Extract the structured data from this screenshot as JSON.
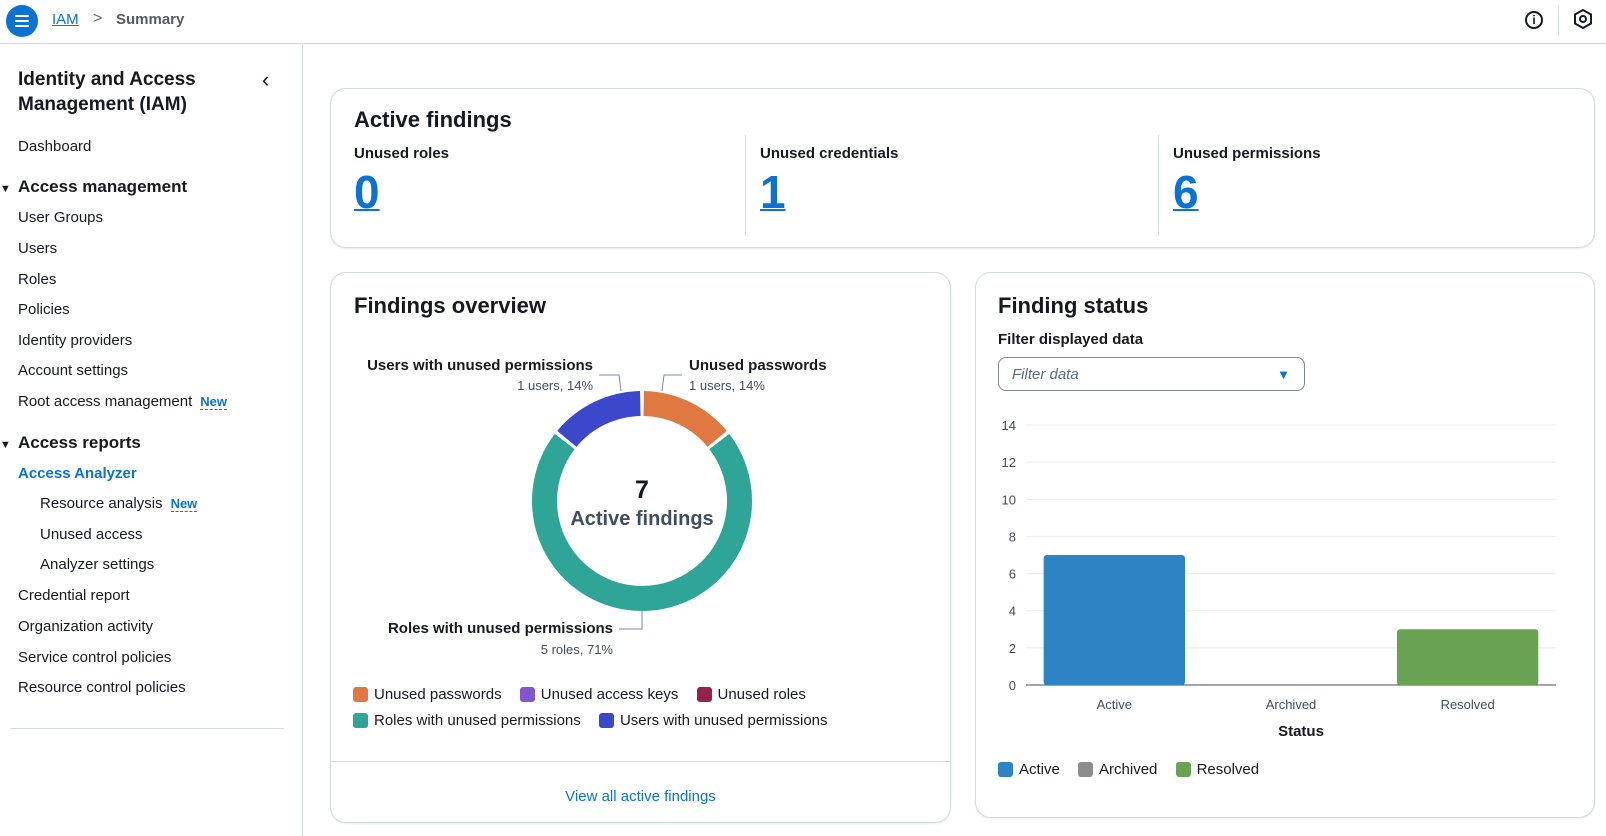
{
  "topbar": {
    "breadcrumb_root": "IAM",
    "breadcrumb_sep": ">",
    "breadcrumb_current": "Summary"
  },
  "sidebar": {
    "title": "Identity and Access Management (IAM)",
    "dashboard": "Dashboard",
    "section_access_management": "Access management",
    "access_management_items": [
      "User Groups",
      "Users",
      "Roles",
      "Policies",
      "Identity providers",
      "Account settings",
      "Root access management"
    ],
    "new_badge": "New",
    "section_access_reports": "Access reports",
    "access_analyzer": "Access Analyzer",
    "analyzer_items": [
      "Resource analysis",
      "Unused access",
      "Analyzer settings"
    ],
    "report_items": [
      "Credential report",
      "Organization activity",
      "Service control policies",
      "Resource control policies"
    ]
  },
  "active_findings": {
    "title": "Active findings",
    "metrics": [
      {
        "label": "Unused roles",
        "value": "0"
      },
      {
        "label": "Unused credentials",
        "value": "1"
      },
      {
        "label": "Unused permissions",
        "value": "6"
      }
    ]
  },
  "findings_overview": {
    "title": "Findings overview",
    "center_value": "7",
    "center_label": "Active findings",
    "callouts": {
      "users_perm_title": "Users with unused permissions",
      "users_perm_detail": "1 users, 14%",
      "passwords_title": "Unused passwords",
      "passwords_detail": "1 users, 14%",
      "roles_perm_title": "Roles with unused permissions",
      "roles_perm_detail": "5 roles, 71%"
    },
    "legend": [
      {
        "label": "Unused passwords",
        "color": "#e07941"
      },
      {
        "label": "Unused access keys",
        "color": "#8456ce"
      },
      {
        "label": "Unused roles",
        "color": "#962249"
      },
      {
        "label": "Roles with unused permissions",
        "color": "#2ea597"
      },
      {
        "label": "Users with unused permissions",
        "color": "#3b48cc"
      }
    ],
    "view_link": "View all active findings"
  },
  "finding_status": {
    "title": "Finding status",
    "filter_label": "Filter displayed data",
    "filter_placeholder": "Filter data",
    "legend": [
      {
        "label": "Active",
        "color": "#2e83c4"
      },
      {
        "label": "Archived",
        "color": "#8d8d8d"
      },
      {
        "label": "Resolved",
        "color": "#67a353"
      }
    ]
  },
  "chart_data": [
    {
      "type": "pie",
      "title": "Findings overview",
      "categories": [
        "Unused passwords",
        "Unused access keys",
        "Unused roles",
        "Roles with unused permissions",
        "Users with unused permissions"
      ],
      "values": [
        1,
        0,
        0,
        5,
        1
      ],
      "colors": [
        "#e07941",
        "#8456ce",
        "#962249",
        "#2ea597",
        "#3b48cc"
      ]
    },
    {
      "type": "bar",
      "title": "Finding status",
      "categories": [
        "Active",
        "Archived",
        "Resolved"
      ],
      "values": [
        7,
        0,
        3
      ],
      "colors": [
        "#2e83c4",
        "#8d8d8d",
        "#67a353"
      ],
      "xlabel": "Status",
      "ylabel": "",
      "ylim": [
        0,
        14
      ],
      "yticks": [
        0,
        2,
        4,
        6,
        8,
        10,
        12,
        14
      ],
      "grid": true
    }
  ]
}
